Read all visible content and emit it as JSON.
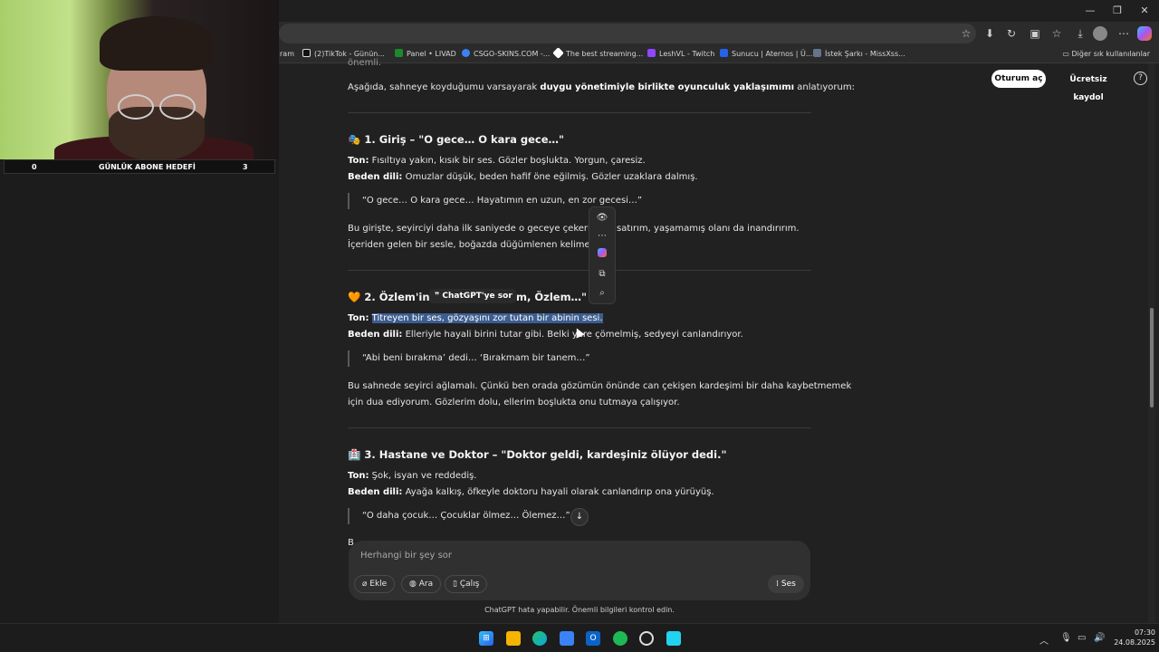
{
  "browser": {
    "bookmarks": [
      {
        "label": "ram",
        "color": "#2b2b2b"
      },
      {
        "label": "(2)TikTok - Günün...",
        "color": "#111111"
      },
      {
        "label": "Panel • LIVAD",
        "color": "#1a8a2a"
      },
      {
        "label": "CSGO-SKINS.COM -...",
        "color": "#3b82f6"
      },
      {
        "label": "The best streaming...",
        "color": "#ffffff"
      },
      {
        "label": "LeshVL - Twitch",
        "color": "#9146ff"
      },
      {
        "label": "Sunucu | Aternos | Ü...",
        "color": "#2563eb"
      },
      {
        "label": "İstek Şarkı - MissXss...",
        "color": "#64748b"
      }
    ],
    "other_bookmarks": "Diğer sık kullanılanlar"
  },
  "overlay": {
    "goal_left": "0",
    "goal_title": "GÜNLÜK ABONE HEDEFİ",
    "goal_right": "3"
  },
  "header": {
    "login": "Oturum aç",
    "signup": "Ücretsiz kaydol",
    "help": "?"
  },
  "article": {
    "partial_top": "önemli.",
    "intro_pre": "Aşağıda, sahneye koyduğumu varsayarak ",
    "intro_bold": "duygu yönetimiyle birlikte oyunculuk yaklaşımımı",
    "intro_post": " anlatıyorum:",
    "s1": {
      "title": "🎭 1. Giriş – \"O gece… O kara gece…\"",
      "ton_label": "Ton:",
      "ton": " Fısıltıya yakın, kısık bir ses. Gözler boşlukta. Yorgun, çaresiz.",
      "body_label": "Beden dili:",
      "body": " Omuzlar düşük, beden hafif öne eğilmiş. Gözler uzaklara dalmış.",
      "quote": "“O gece… O kara gece… Hayatımın en uzun, en zor gecesi…”",
      "para1_a": "Bu girişte, seyirciyi daha ilk saniyede o geceye çekerim. O",
      "para1_b": "satırım, yaşamamış olanı da inandırırım.",
      "para2": "İçeriden gelen bir sesle, boğazda düğümlenen kelimelerle."
    },
    "s2": {
      "title_a": "🧡 2. Özlem'in S",
      "title_b": "m, Özlem…\"",
      "ton_label": "Ton:",
      "ton_selected": "Titreyen bir ses, gözyaşını zor tutan bir abinin sesi.",
      "body_label": "Beden dili:",
      "body": " Elleriyle hayali birini tutar gibi. Belki yere çömelmiş, sedyeyi canlandırıyor.",
      "quote": "“Abi beni bırakma’ dedi… ‘Bırakmam bir tanem…”",
      "para1": "Bu sahnede seyirci ağlamalı. Çünkü ben orada gözümün önünde can çekişen kardeşimi bir daha kaybetmemek",
      "para2": "için dua ediyorum. Gözlerim dolu, ellerim boşlukta onu tutmaya çalışıyor."
    },
    "s3": {
      "title": "🏥 3. Hastane ve Doktor – \"Doktor geldi, kardeşiniz ölüyor dedi.\"",
      "ton_label": "Ton:",
      "ton": " Şok, isyan ve reddediş.",
      "body_label": "Beden dili:",
      "body": " Ayağa kalkış, öfkeyle doktoru hayali olarak canlandırıp ona yürüyüş.",
      "quote": "“O daha çocuk… Çocuklar ölmez… Ölemez…”",
      "partial": "B"
    }
  },
  "popup": {
    "ask": "❞ ChatGPT'ye sor"
  },
  "composer": {
    "placeholder": "Herhangi bir şey sor",
    "attach": "Ekle",
    "search": "Ara",
    "study": "Çalış",
    "voice": "Ses",
    "footnote": "ChatGPT hata yapabilir. Önemli bilgileri kontrol edin."
  },
  "taskbar": {
    "time": "07:30",
    "date": "24.08.2025"
  }
}
